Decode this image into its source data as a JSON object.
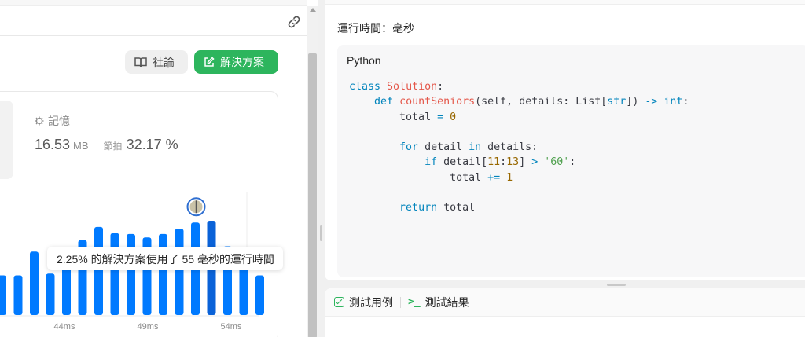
{
  "left": {
    "discuss_label": "社論",
    "solution_label": "解決方案",
    "memory": {
      "label": "記憶",
      "value": "16.53",
      "unit": "MB",
      "beats_label": "節拍",
      "beats_value": "32.17 %"
    },
    "tooltip": "2.25% 的解決方案使用了 55 毫秒的運行時間"
  },
  "chart_data": {
    "type": "bar",
    "x_ticks": [
      "44ms",
      "49ms",
      "54ms"
    ],
    "values_relative": [
      0.45,
      0.45,
      0.72,
      0.47,
      0.58,
      0.85,
      1.0,
      0.93,
      0.92,
      0.88,
      0.92,
      0.98,
      1.05,
      1.07,
      0.78,
      0.6,
      0.45,
      0.3
    ],
    "highlighted_index": 13,
    "colors": {
      "bar": "#007aff",
      "highlight": "#0a62d8"
    }
  },
  "code_panel": {
    "runtime_text": "運行時間：毫秒",
    "language": "Python"
  },
  "test_panel": {
    "tab_cases": "測試用例",
    "tab_results": "測試結果"
  }
}
